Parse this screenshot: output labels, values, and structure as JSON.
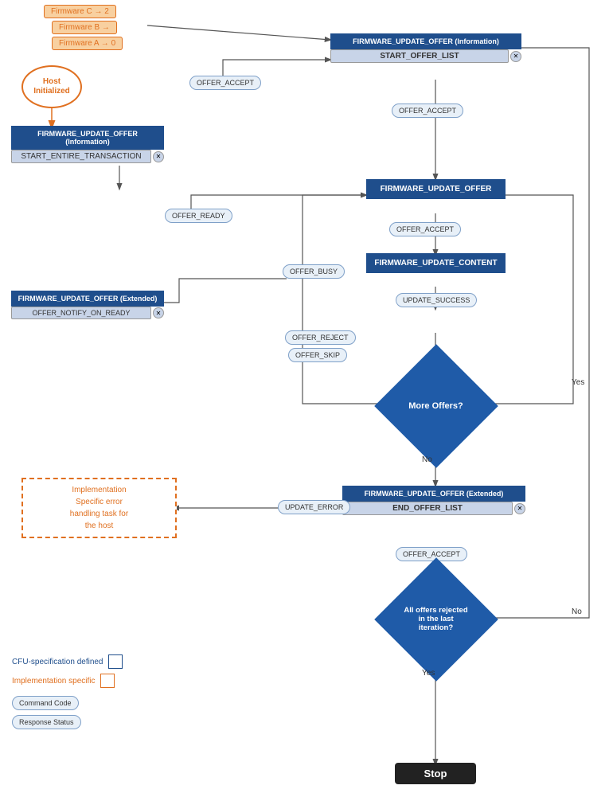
{
  "firmware_labels": {
    "c": "Firmware C → 2",
    "b": "Firmware B →",
    "a": "Firmware A → 0"
  },
  "host_initialized": "Host\nInitialized",
  "boxes": {
    "start_offer_list_top_label": "FIRMWARE_UPDATE_OFFER (Information)",
    "start_offer_list_label": "START_OFFER_LIST",
    "start_entire_top_label": "FIRMWARE_UPDATE_OFFER (Information)",
    "start_entire_label": "START_ENTIRE_TRANSACTION",
    "firmware_update_offer": "FIRMWARE_UPDATE_OFFER",
    "firmware_update_content": "FIRMWARE_UPDATE_CONTENT",
    "offer_notify_top_label": "FIRMWARE_UPDATE_OFFER (Extended)",
    "offer_notify_label": "OFFER_NOTIFY_ON_READY",
    "end_offer_top_label": "FIRMWARE_UPDATE_OFFER (Extended)",
    "end_offer_label": "END_OFFER_LIST"
  },
  "pills": {
    "offer_accept_1": "OFFER_ACCEPT",
    "offer_accept_2": "OFFER_ACCEPT",
    "offer_accept_3": "OFFER_ACCEPT",
    "offer_accept_4": "OFFER_ACCEPT",
    "offer_ready": "OFFER_READY",
    "offer_busy": "OFFER_BUSY",
    "offer_reject": "OFFER_REJECT",
    "offer_skip": "OFFER_SKIP",
    "update_success": "UPDATE_SUCCESS",
    "update_error": "UPDATE_ERROR"
  },
  "diamonds": {
    "more_offers": "More Offers?",
    "all_rejected": "All offers rejected\nin the last\niteration?"
  },
  "labels": {
    "yes1": "Yes",
    "no1": "No",
    "no2": "No",
    "yes2": "Yes"
  },
  "impl_error": "Implementation\nSpecific error\nhandling task for\nthe host",
  "stop": "Stop",
  "legend": {
    "cfu_label": "CFU-specification defined",
    "impl_label": "Implementation specific",
    "command_code": "Command Code",
    "response_status": "Response Status"
  }
}
